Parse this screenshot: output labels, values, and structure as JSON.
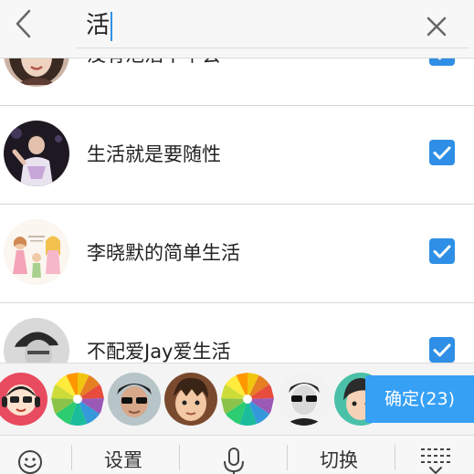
{
  "search": {
    "query": "活",
    "back_icon": "chevron-left-icon",
    "clear_icon": "close-icon"
  },
  "contacts": [
    {
      "name": "没有池浩干中会",
      "avatar": "woman-portrait-avatar",
      "checked": true
    },
    {
      "name": "生活就是要随性",
      "avatar": "singer-stage-avatar",
      "checked": true
    },
    {
      "name": "李晓默的简单生活",
      "avatar": "cartoon-family-avatar",
      "checked": true
    },
    {
      "name": "不配爱Jay爱生活",
      "avatar": "man-hat-avatar",
      "checked": true
    }
  ],
  "selected": {
    "avatars": [
      "cartoon-headphones-avatar",
      "color-pencils-avatar",
      "boy-sunglasses-avatar",
      "cartoon-boy-avatar",
      "color-pencils-avatar",
      "man-sunglasses-avatar",
      "cartoon-girl-avatar"
    ],
    "confirm_label": "确定(23)"
  },
  "ime_bar": {
    "emoji_icon": "smiley-icon",
    "settings_label": "设置",
    "voice_icon": "microphone-icon",
    "switch_label": "切换",
    "collapse_icon": "keyboard-collapse-icon"
  },
  "colors": {
    "accent": "#2f8fe6",
    "confirm_button": "#36a0f5",
    "header_background": "#f7f7f7",
    "strip_background": "#f4f4f4"
  }
}
